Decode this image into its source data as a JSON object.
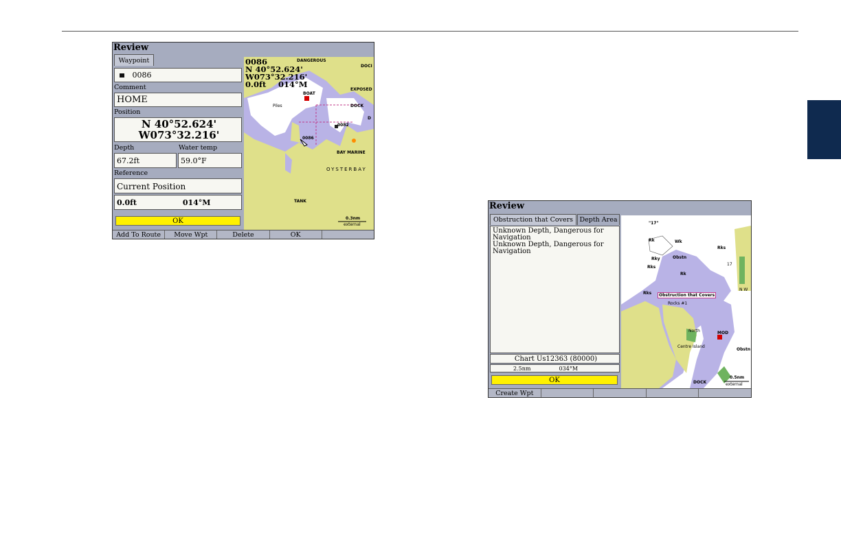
{
  "screen1": {
    "title": "Review",
    "tab": "Waypoint",
    "waypoint_name": "0086",
    "comment_label": "Comment",
    "comment_value": "HOME",
    "position_label": "Position",
    "lat": "N  40°52.624'",
    "lon": "W073°32.216'",
    "depth_label": "Depth",
    "water_temp_label": "Water temp",
    "depth_value": "67.2ft",
    "water_temp_value": "59.0°F",
    "reference_label": "Reference",
    "reference_value": "Current Position",
    "ref_distance": "0.0ft",
    "ref_bearing": "014°M",
    "ok": "OK",
    "softkeys": [
      "Add To Route",
      "Move Wpt",
      "Delete",
      "OK",
      ""
    ],
    "map": {
      "wp_name": "0086",
      "lat": "N  40°52.624'",
      "lon": "W073°32.216'",
      "distance": "0.0ft",
      "bearing": "014°M",
      "labels": [
        "DANGEROUS",
        "DOCI",
        "EXPOSED",
        "BOAT",
        "Piles",
        "DOCK",
        "D",
        "0082",
        "0086",
        "BAY MARINE",
        "OYSTERBAY",
        "TANK"
      ],
      "scale": "0.3nm",
      "scale_sub": "external"
    }
  },
  "screen2": {
    "title": "Review",
    "tabs": [
      "Obstruction that Covers",
      "Depth Area"
    ],
    "lines": [
      "Unknown Depth, Dangerous for Navigation",
      "Unknown Depth, Dangerous for Navigation"
    ],
    "chart": "Chart Us12363 (80000)",
    "distance": "2.5nm",
    "bearing": "034°M",
    "ok": "OK",
    "softkeys": [
      "Create Wpt",
      "",
      "",
      "",
      ""
    ],
    "map": {
      "labels": [
        "\"17\"",
        "Rk",
        "Wk",
        "Rks",
        "Obstn",
        "Rky",
        "Rk",
        "Rks",
        "Obstruction that Covers",
        "Rocks #1",
        "Rks",
        "N W",
        "17",
        "North",
        "MOD",
        "Centre Island",
        "Obstn",
        "DOCK"
      ],
      "scale": "0.5nm",
      "scale_sub": "external"
    }
  }
}
